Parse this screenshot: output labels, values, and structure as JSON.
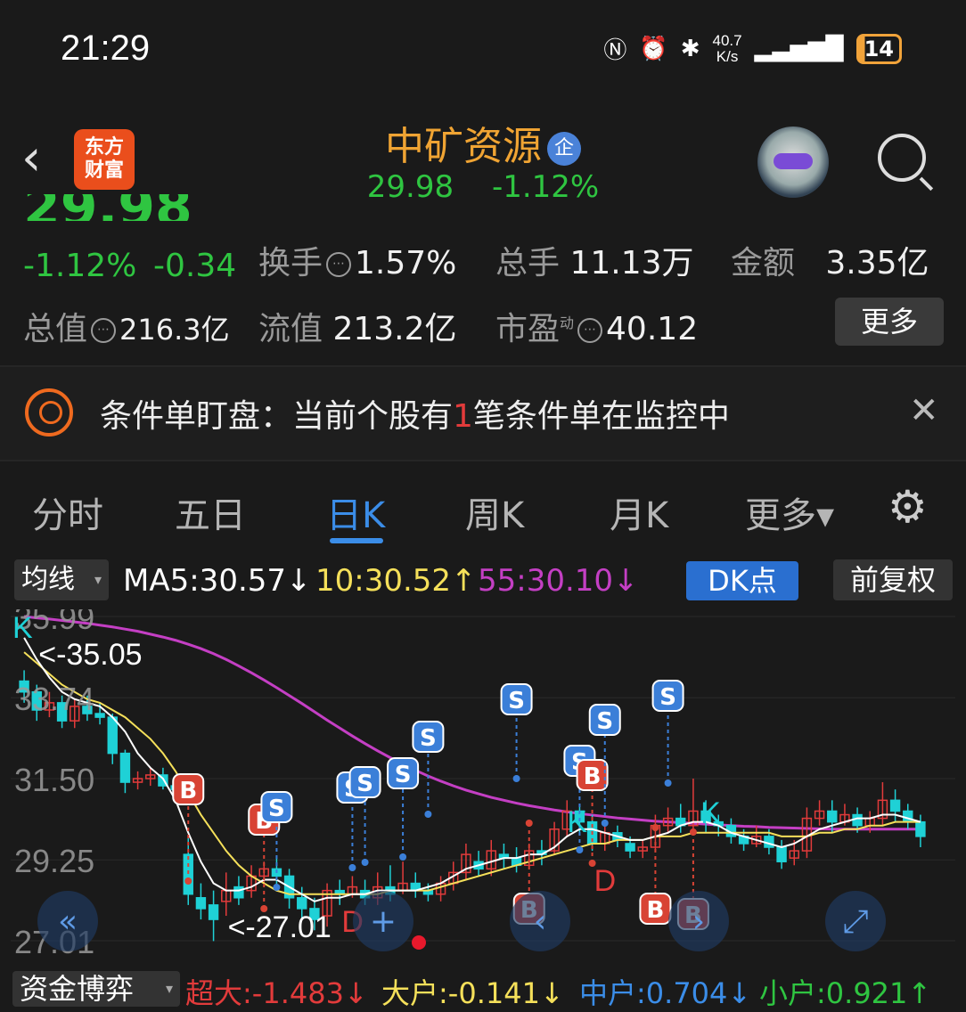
{
  "status": {
    "time": "21:29",
    "net_speed_top": "40.7",
    "net_speed_bottom": "K/s",
    "battery": "14"
  },
  "header": {
    "logo_top": "东方",
    "logo_bottom": "财富",
    "stock_name": "中矿资源",
    "badge": "企",
    "price": "29.98",
    "change_pct": "-1.12%"
  },
  "quote": {
    "change_pct": "-1.12%",
    "change_abs": "-0.34",
    "turnover_label": "换手",
    "turnover_value": "1.57%",
    "volume_label": "总手",
    "volume_value": "11.13万",
    "amount_label": "金额",
    "amount_value": "3.35亿",
    "total_cap_label": "总值",
    "total_cap_value": "216.3亿",
    "float_cap_label": "流值",
    "float_cap_value": "213.2亿",
    "pe_label": "市盈",
    "pe_sup": "动",
    "pe_value": "40.12",
    "more_label": "更多"
  },
  "condition": {
    "prefix": "条件单盯盘：当前个股有",
    "count": "1",
    "suffix": "笔条件单在监控中"
  },
  "tabs": [
    {
      "label": "分时"
    },
    {
      "label": "五日"
    },
    {
      "label": "日K"
    },
    {
      "label": "周K"
    },
    {
      "label": "月K"
    },
    {
      "label": "更多▾"
    }
  ],
  "ma_bar": {
    "selector": "均线",
    "ma5": "MA5:30.57↓",
    "ma10": "10:30.52↑",
    "ma55": "55:30.10↓",
    "dk": "DK点",
    "adjust": "前复权"
  },
  "chart_data": {
    "type": "candlestick",
    "y_ticks": [
      "35.99",
      "33.74",
      "31.50",
      "29.25",
      "27.01"
    ],
    "ylim": [
      27.01,
      35.99
    ],
    "annotations": {
      "high": "<-35.05",
      "low": "<-27.01"
    },
    "candles": [
      [
        34.2,
        33.9,
        34.5,
        33.6
      ],
      [
        33.9,
        33.4,
        34.1,
        33.1
      ],
      [
        33.4,
        33.6,
        33.9,
        33.2
      ],
      [
        33.6,
        33.1,
        33.8,
        32.9
      ],
      [
        33.1,
        33.5,
        33.7,
        32.9
      ],
      [
        33.5,
        33.3,
        33.8,
        33.1
      ],
      [
        33.3,
        33.2,
        33.6,
        33.0
      ],
      [
        33.2,
        32.2,
        33.3,
        31.9
      ],
      [
        32.2,
        31.4,
        32.3,
        31.1
      ],
      [
        31.4,
        31.5,
        31.7,
        31.2
      ],
      [
        31.5,
        31.6,
        31.8,
        31.3
      ],
      [
        31.6,
        31.3,
        31.8,
        31.2
      ],
      [
        31.3,
        31.2,
        31.5,
        31.0
      ],
      [
        29.4,
        28.3,
        29.9,
        28.0
      ],
      [
        28.2,
        27.9,
        28.6,
        27.6
      ],
      [
        28.0,
        27.6,
        28.4,
        27.0
      ],
      [
        28.1,
        28.4,
        28.9,
        27.7
      ],
      [
        28.5,
        28.2,
        28.8,
        28.0
      ],
      [
        28.4,
        28.8,
        29.1,
        28.2
      ],
      [
        28.8,
        29.0,
        29.2,
        28.6
      ],
      [
        29.0,
        28.8,
        29.3,
        28.5
      ],
      [
        28.8,
        28.2,
        29.0,
        27.9
      ],
      [
        28.2,
        27.9,
        28.5,
        27.6
      ],
      [
        27.9,
        27.6,
        28.2,
        27.3
      ],
      [
        27.7,
        28.4,
        28.6,
        27.4
      ],
      [
        28.4,
        28.3,
        28.7,
        28.0
      ],
      [
        28.3,
        28.5,
        28.8,
        28.2
      ],
      [
        28.4,
        28.2,
        28.7,
        28.0
      ],
      [
        28.2,
        28.5,
        28.9,
        28.0
      ],
      [
        28.5,
        28.3,
        29.1,
        28.1
      ],
      [
        28.4,
        28.6,
        29.2,
        28.3
      ],
      [
        28.6,
        28.4,
        28.9,
        28.2
      ],
      [
        28.4,
        28.3,
        28.6,
        28.1
      ],
      [
        28.3,
        28.6,
        28.8,
        28.1
      ],
      [
        28.6,
        28.9,
        29.2,
        28.4
      ],
      [
        28.9,
        29.4,
        29.7,
        28.7
      ],
      [
        29.2,
        29.0,
        29.5,
        28.8
      ],
      [
        29.0,
        29.5,
        29.8,
        28.8
      ],
      [
        29.4,
        29.3,
        29.7,
        29.0
      ],
      [
        29.3,
        29.1,
        29.6,
        28.9
      ],
      [
        29.1,
        29.5,
        29.7,
        29.0
      ],
      [
        29.5,
        29.4,
        29.8,
        29.1
      ],
      [
        29.5,
        30.1,
        30.3,
        29.4
      ],
      [
        30.1,
        30.6,
        30.9,
        29.9
      ],
      [
        30.6,
        30.3,
        30.8,
        30.0
      ],
      [
        30.3,
        29.7,
        30.5,
        29.5
      ],
      [
        29.7,
        30.0,
        30.3,
        29.5
      ],
      [
        30.0,
        29.8,
        30.2,
        29.6
      ],
      [
        29.7,
        29.5,
        29.9,
        29.3
      ],
      [
        29.5,
        29.6,
        29.8,
        29.3
      ],
      [
        29.6,
        30.2,
        30.5,
        29.5
      ],
      [
        30.2,
        30.4,
        30.7,
        30.0
      ],
      [
        30.4,
        30.2,
        30.8,
        30.0
      ],
      [
        30.2,
        30.6,
        31.5,
        30.1
      ],
      [
        30.6,
        30.3,
        30.9,
        30.0
      ],
      [
        30.3,
        30.2,
        30.5,
        29.9
      ],
      [
        30.2,
        29.9,
        30.4,
        29.7
      ],
      [
        29.9,
        29.7,
        30.1,
        29.5
      ],
      [
        29.7,
        29.9,
        30.2,
        29.6
      ],
      [
        29.9,
        29.6,
        30.1,
        29.4
      ],
      [
        29.6,
        29.2,
        29.8,
        29.0
      ],
      [
        29.3,
        29.5,
        29.8,
        29.1
      ],
      [
        29.5,
        30.4,
        30.7,
        29.3
      ],
      [
        30.4,
        30.6,
        30.9,
        30.2
      ],
      [
        30.6,
        30.3,
        30.9,
        30.0
      ],
      [
        30.3,
        30.5,
        30.8,
        30.2
      ],
      [
        30.5,
        30.2,
        30.7,
        30.0
      ],
      [
        30.2,
        30.4,
        30.6,
        30.0
      ],
      [
        30.4,
        30.9,
        31.4,
        30.2
      ],
      [
        30.9,
        30.6,
        31.2,
        30.3
      ],
      [
        30.6,
        30.3,
        30.8,
        30.1
      ],
      [
        30.3,
        29.9,
        30.5,
        29.6
      ]
    ],
    "ma5": [
      35.4,
      34.8,
      34.3,
      33.9,
      33.7,
      33.6,
      33.5,
      33.2,
      32.8,
      32.2,
      31.8,
      31.5,
      30.9,
      30.0,
      29.2,
      28.6,
      28.4,
      28.4,
      28.5,
      28.7,
      28.7,
      28.5,
      28.3,
      28.1,
      28.2,
      28.2,
      28.3,
      28.3,
      28.4,
      28.4,
      28.4,
      28.4,
      28.5,
      28.6,
      28.8,
      29.0,
      29.1,
      29.2,
      29.3,
      29.3,
      29.4,
      29.4,
      29.6,
      29.9,
      30.1,
      30.1,
      30.0,
      29.9,
      29.8,
      29.8,
      29.9,
      30.0,
      30.2,
      30.3,
      30.3,
      30.2,
      30.0,
      29.9,
      29.8,
      29.7,
      29.6,
      29.7,
      29.9,
      30.1,
      30.2,
      30.3,
      30.4,
      30.4,
      30.5,
      30.5,
      30.4,
      30.3
    ],
    "ma10": [
      35.0,
      34.7,
      34.4,
      34.1,
      33.9,
      33.7,
      33.6,
      33.4,
      33.2,
      32.9,
      32.6,
      32.2,
      31.7,
      31.1,
      30.5,
      30.0,
      29.5,
      29.1,
      28.8,
      28.6,
      28.4,
      28.3,
      28.3,
      28.3,
      28.3,
      28.3,
      28.3,
      28.3,
      28.3,
      28.4,
      28.4,
      28.4,
      28.4,
      28.5,
      28.6,
      28.7,
      28.8,
      28.9,
      29.0,
      29.1,
      29.2,
      29.3,
      29.4,
      29.5,
      29.6,
      29.7,
      29.7,
      29.8,
      29.8,
      29.8,
      29.9,
      29.9,
      29.9,
      30.0,
      30.0,
      30.0,
      30.0,
      30.0,
      30.0,
      30.0,
      29.9,
      29.9,
      29.9,
      30.0,
      30.0,
      30.1,
      30.1,
      30.2,
      30.2,
      30.3,
      30.3,
      30.3
    ],
    "ma55": [
      35.99,
      35.95,
      35.92,
      35.88,
      35.84,
      35.8,
      35.75,
      35.7,
      35.64,
      35.58,
      35.5,
      35.42,
      35.33,
      35.22,
      35.1,
      34.96,
      34.8,
      34.62,
      34.43,
      34.23,
      34.02,
      33.8,
      33.58,
      33.35,
      33.12,
      32.9,
      32.68,
      32.47,
      32.27,
      32.08,
      31.9,
      31.73,
      31.57,
      31.43,
      31.3,
      31.18,
      31.08,
      30.98,
      30.9,
      30.82,
      30.75,
      30.69,
      30.63,
      30.58,
      30.53,
      30.49,
      30.45,
      30.41,
      30.38,
      30.35,
      30.32,
      30.3,
      30.28,
      30.26,
      30.24,
      30.22,
      30.2,
      30.18,
      30.17,
      30.15,
      30.14,
      30.13,
      30.12,
      30.11,
      30.1,
      30.1,
      30.1,
      30.1,
      30.1,
      30.1,
      30.1,
      30.1
    ]
  },
  "chart_controls": {
    "prev_page": "«",
    "add": "+",
    "back": "‹",
    "forward": "›",
    "fullscreen": "⤢"
  },
  "fund_flow": {
    "selector": "资金博弈",
    "super": "超大:-1.483↓",
    "large": "大户:-0.141↓",
    "medium": "中户:0.704↓",
    "small": "小户:0.921↑"
  },
  "colors": {
    "up": "#e23b3b",
    "down": "#1fd1d6",
    "ma5": "#ffffff",
    "ma10": "#f5e05a",
    "ma55": "#c43fc4",
    "buy": "#d84334",
    "sell": "#3b7fd8"
  }
}
